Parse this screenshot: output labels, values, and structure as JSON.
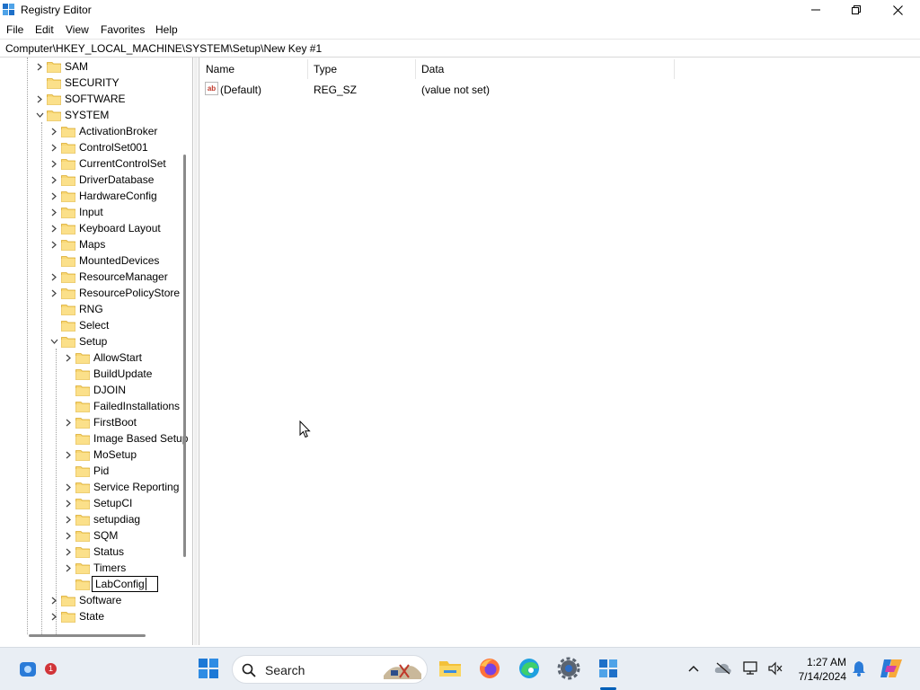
{
  "window": {
    "title": "Registry Editor"
  },
  "menu": [
    "File",
    "Edit",
    "View",
    "Favorites",
    "Help"
  ],
  "address": "Computer\\HKEY_LOCAL_MACHINE\\SYSTEM\\Setup\\New Key #1",
  "tree": [
    {
      "label": "SAM",
      "expander": "collapsed"
    },
    {
      "label": "SECURITY",
      "expander": "none"
    },
    {
      "label": "SOFTWARE",
      "expander": "collapsed"
    },
    {
      "label": "SYSTEM",
      "expander": "expanded"
    },
    {
      "label": "ActivationBroker",
      "expander": "collapsed"
    },
    {
      "label": "ControlSet001",
      "expander": "collapsed"
    },
    {
      "label": "CurrentControlSet",
      "expander": "collapsed"
    },
    {
      "label": "DriverDatabase",
      "expander": "collapsed"
    },
    {
      "label": "HardwareConfig",
      "expander": "collapsed"
    },
    {
      "label": "Input",
      "expander": "collapsed"
    },
    {
      "label": "Keyboard Layout",
      "expander": "collapsed"
    },
    {
      "label": "Maps",
      "expander": "collapsed"
    },
    {
      "label": "MountedDevices",
      "expander": "none"
    },
    {
      "label": "ResourceManager",
      "expander": "collapsed"
    },
    {
      "label": "ResourcePolicyStore",
      "expander": "collapsed"
    },
    {
      "label": "RNG",
      "expander": "none"
    },
    {
      "label": "Select",
      "expander": "none"
    },
    {
      "label": "Setup",
      "expander": "expanded"
    },
    {
      "label": "AllowStart",
      "expander": "collapsed"
    },
    {
      "label": "BuildUpdate",
      "expander": "none"
    },
    {
      "label": "DJOIN",
      "expander": "none"
    },
    {
      "label": "FailedInstallations",
      "expander": "none"
    },
    {
      "label": "FirstBoot",
      "expander": "collapsed"
    },
    {
      "label": "Image Based Setup",
      "expander": "none"
    },
    {
      "label": "MoSetup",
      "expander": "collapsed"
    },
    {
      "label": "Pid",
      "expander": "none"
    },
    {
      "label": "Service Reporting",
      "expander": "collapsed"
    },
    {
      "label": "SetupCI",
      "expander": "collapsed"
    },
    {
      "label": "setupdiag",
      "expander": "collapsed"
    },
    {
      "label": "SQM",
      "expander": "collapsed"
    },
    {
      "label": "Status",
      "expander": "collapsed"
    },
    {
      "label": "Timers",
      "expander": "collapsed"
    },
    {
      "label": "LabConfig",
      "expander": "none",
      "editing": true
    },
    {
      "label": "Software",
      "expander": "collapsed"
    },
    {
      "label": "State",
      "expander": "collapsed"
    }
  ],
  "values": {
    "headers": [
      "Name",
      "Type",
      "Data"
    ],
    "rows": [
      {
        "name": "(Default)",
        "type": "REG_SZ",
        "data": "(value not set)",
        "icon": "ab-string-icon"
      }
    ]
  },
  "taskbar": {
    "search_label": "Search",
    "notification_count": "1",
    "time": "1:27 AM",
    "date": "7/14/2024",
    "pinned": [
      "copilot-chat-icon",
      "start-icon",
      "file-explorer-icon",
      "firefox-icon",
      "edge-icon",
      "settings-icon",
      "registry-editor-icon"
    ]
  },
  "colors": {
    "folder": "#f8d775",
    "accent": "#005fb8"
  }
}
